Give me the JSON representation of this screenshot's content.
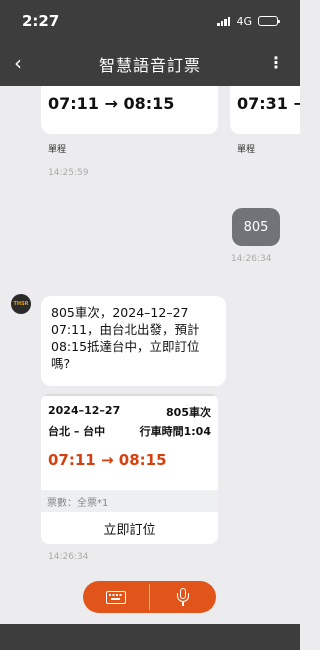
{
  "status_bar": {
    "time": "2:27",
    "network": "4G"
  },
  "nav": {
    "title": "智慧語音訂票"
  },
  "chat": {
    "prev_cards": [
      {
        "times": "07:11 → 08:15",
        "trip_type": "單程"
      },
      {
        "times": "07:31 → ",
        "trip_type": "單程"
      }
    ],
    "timestamp_1": "14:25:59",
    "user_message": {
      "text": "805",
      "time": "14:26:34"
    },
    "bot_message": {
      "avatar_text": "THSR",
      "text": "805車次，2024–12–27 07:11，由台北出發，預計08:15抵達台中，立即訂位嗎?"
    },
    "ticket": {
      "date": "2024–12–27",
      "train": "805車次",
      "route": "台北 – 台中",
      "duration": "行車時間1:04",
      "times": "07:11 → 08:15",
      "tickets": "票數：全票*1",
      "book_label": "立即訂位"
    },
    "timestamp_2": "14:26:34"
  },
  "input_bar": {
    "left_icon": "keyboard-icon",
    "right_icon": "microphone-icon"
  },
  "colors": {
    "accent": "#e1551b",
    "header": "#3d3d3d",
    "time_red": "#d6400e",
    "user_bubble": "#707479"
  }
}
